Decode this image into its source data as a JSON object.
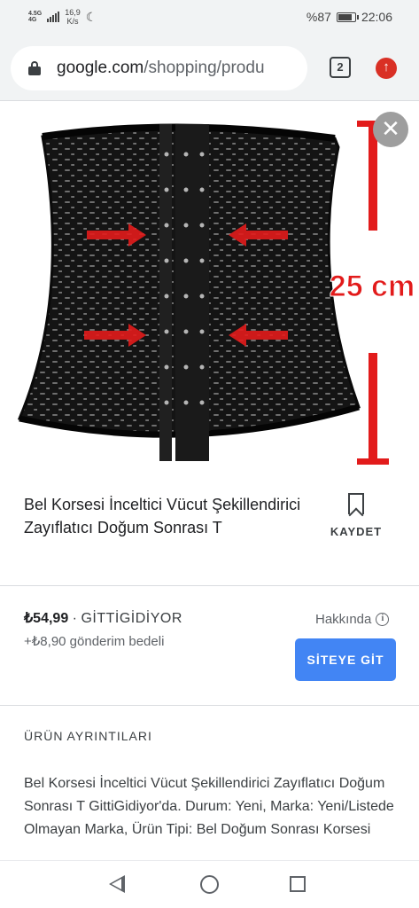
{
  "status_bar": {
    "network_type": "4.5G",
    "network_sub": "4G",
    "speed_value": "16,9",
    "speed_unit": "K/s",
    "battery": "%87",
    "battery_level": 0.87,
    "time": "22:06"
  },
  "address_bar": {
    "url_host": "google.com",
    "url_path": "/shopping/produ",
    "tab_count": "2",
    "update_icon": "arrow-up"
  },
  "product": {
    "image_text": "25 cm",
    "title": "Bel Korsesi İnceltici Vücut Şekillendirici Zayıflatıcı Doğum Sonrası T",
    "save_label": "KAYDET"
  },
  "offer": {
    "price": "₺54,99",
    "separator": "·",
    "seller": "GİTTİGİDİYOR",
    "shipping": "+₺8,90 gönderim bedeli",
    "about_label": "Hakkında",
    "site_button": "SİTEYE GİT"
  },
  "details": {
    "heading": "ÜRÜN AYRINTILARI",
    "text": "Bel Korsesi İnceltici Vücut Şekillendirici Zayıflatıcı Doğum Sonrası T GittiGidiyor'da. Durum: Yeni, Marka: Yeni/Listede Olmayan Marka, Ürün Tipi: Bel Doğum Sonrası Korsesi"
  },
  "colors": {
    "accent_blue": "#4285f4",
    "arrow_red": "#e21b1b",
    "corset_black": "#111111"
  }
}
